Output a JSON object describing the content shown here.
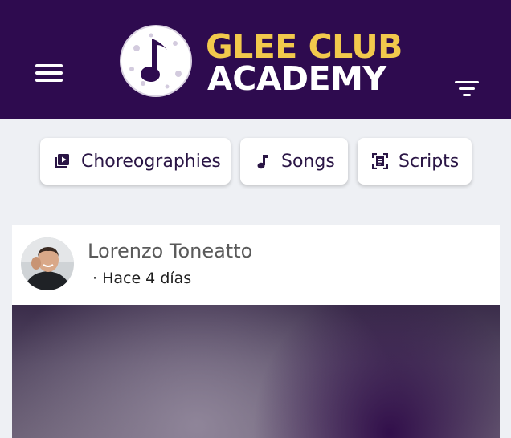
{
  "header": {
    "brand_line_1": "GLEE CLUB",
    "brand_line_2": "ACADEMY",
    "background_color": "#2e0b4f",
    "brand_accent_color": "#f2c94c",
    "menu_icon": "hamburger-menu-icon",
    "filter_icon": "filter-icon",
    "logo_icon": "music-note-logo-icon"
  },
  "categories": [
    {
      "label": "Choreographies",
      "icon": "video-library-icon"
    },
    {
      "label": "Songs",
      "icon": "music-note-icon"
    },
    {
      "label": "Scripts",
      "icon": "document-scan-icon"
    }
  ],
  "post": {
    "author": "Lorenzo Toneatto",
    "time": "· Hace 4 días"
  }
}
